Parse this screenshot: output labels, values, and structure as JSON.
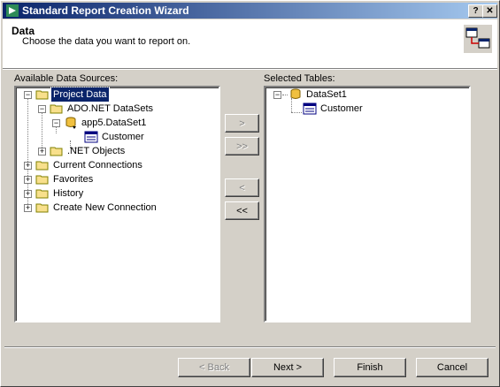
{
  "window": {
    "title": "Standard Report Creation Wizard",
    "help_label": "?",
    "close_label": "✕"
  },
  "header": {
    "title": "Data",
    "subtitle": "Choose the data you want to report on."
  },
  "available": {
    "label": "Available Data Sources:",
    "nodes": {
      "project_data": "Project Data",
      "ado_datasets": "ADO.NET DataSets",
      "app5_dataset": "app5.DataSet1",
      "customer": "Customer",
      "net_objects": ".NET Objects",
      "current_connections": "Current Connections",
      "favorites": "Favorites",
      "history": "History",
      "create_new": "Create New Connection"
    }
  },
  "selected": {
    "label": "Selected Tables:",
    "nodes": {
      "dataset1": "DataSet1",
      "customer": "Customer"
    }
  },
  "move_buttons": {
    "add": ">",
    "add_all": ">>",
    "remove": "<",
    "remove_all": "<<"
  },
  "footer": {
    "back": "< Back",
    "next": "Next >",
    "finish": "Finish",
    "cancel": "Cancel"
  }
}
